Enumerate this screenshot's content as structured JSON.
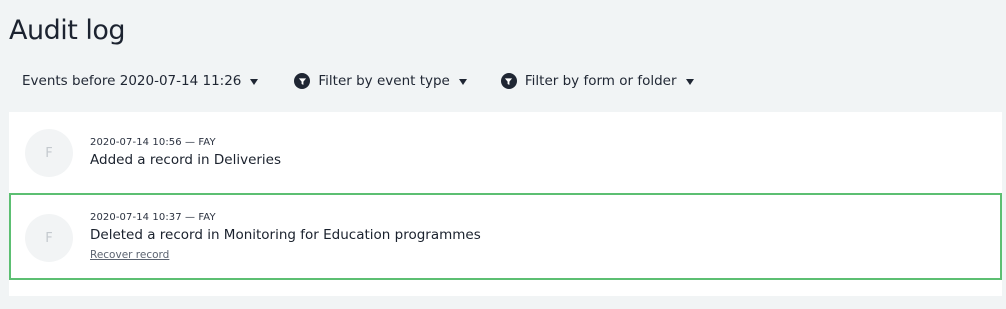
{
  "page": {
    "title": "Audit log"
  },
  "toolbar": {
    "date_filter_label": "Events before 2020-07-14 11:26",
    "event_type_filter_label": "Filter by event type",
    "form_folder_filter_label": "Filter by form or folder"
  },
  "entries": [
    {
      "avatar_initial": "F",
      "meta": "2020-07-14 10:56 — FAY",
      "description": "Added a record in Deliveries"
    },
    {
      "avatar_initial": "F",
      "meta": "2020-07-14 10:37 — FAY",
      "description": "Deleted a record in Monitoring for Education programmes",
      "action_label": "Recover record",
      "selected": true
    }
  ],
  "colors": {
    "background": "#f1f4f5",
    "selected_border": "#5cbf72",
    "text": "#1d2430"
  },
  "icons": {
    "filter": "filter-icon",
    "dropdown": "chevron-down-icon"
  }
}
